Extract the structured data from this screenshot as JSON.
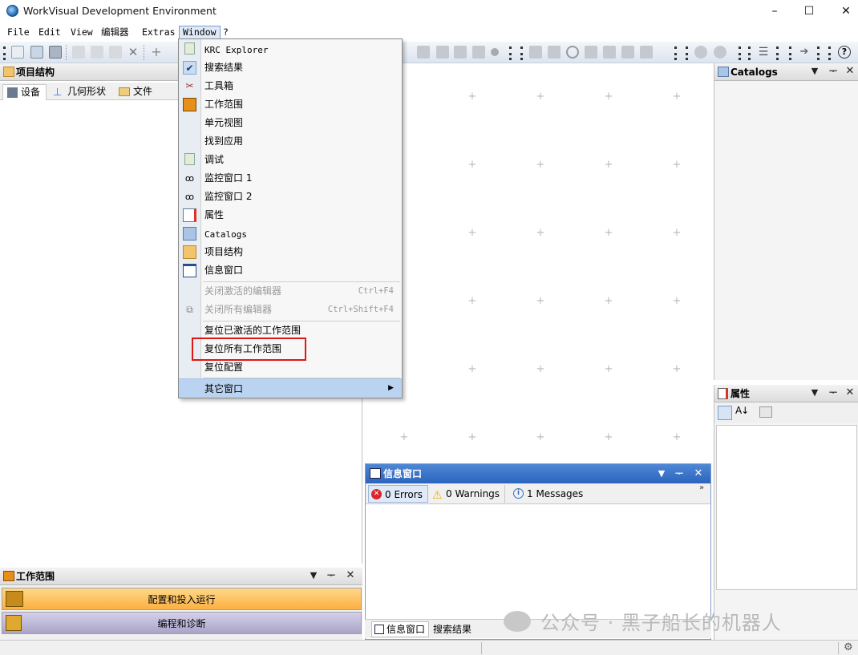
{
  "window": {
    "title": "WorkVisual Development Environment",
    "minimize": "–",
    "maximize": "☐",
    "close": "✕"
  },
  "menubar": {
    "file": "File",
    "edit": "Edit",
    "view": "View",
    "editor": "编辑器",
    "extras": "Extras",
    "window": "Window",
    "help": "?"
  },
  "project_panel": {
    "title": "项目结构",
    "tabs": [
      "设备",
      "几何形状",
      "文件"
    ]
  },
  "work_panel": {
    "title": "工作范围",
    "items": [
      "配置和投入运行",
      "编程和诊断"
    ]
  },
  "catalogs_panel": {
    "title": "Catalogs"
  },
  "properties_panel": {
    "title": "属性"
  },
  "info_window": {
    "title": "信息窗口",
    "errors": "0 Errors",
    "warnings": "0 Warnings",
    "messages": "1 Messages",
    "bottom_tabs": [
      "信息窗口",
      "搜索结果"
    ]
  },
  "window_menu": {
    "items": [
      {
        "label": "KRC Explorer",
        "icon": "krc-explorer-icon"
      },
      {
        "label": "搜索结果",
        "icon": "checkmark-icon"
      },
      {
        "label": "工具箱",
        "icon": "toolbox-icon"
      },
      {
        "label": "工作范围",
        "icon": "workspace-icon"
      },
      {
        "label": "单元视图",
        "icon": ""
      },
      {
        "label": "找到应用",
        "icon": ""
      },
      {
        "label": "调试",
        "icon": "debug-icon"
      },
      {
        "label": "监控窗口 1",
        "icon": "glasses-icon"
      },
      {
        "label": "监控窗口 2",
        "icon": "glasses-icon"
      },
      {
        "label": "属性",
        "icon": "properties-icon"
      },
      {
        "label": "Catalogs",
        "icon": "catalogs-icon"
      },
      {
        "label": "项目结构",
        "icon": "project-structure-icon"
      },
      {
        "label": "信息窗口",
        "icon": "info-window-icon"
      }
    ],
    "close_active": {
      "label": "关闭激活的编辑器",
      "shortcut": "Ctrl+F4"
    },
    "close_all": {
      "label": "关闭所有编辑器",
      "shortcut": "Ctrl+Shift+F4"
    },
    "reset_active": "复位已激活的工作范围",
    "reset_all": "复位所有工作范围",
    "reset_config": "复位配置",
    "other_windows": "其它窗口",
    "submenu_arrow": "▶"
  },
  "watermark": "公众号 · 黑子船长的机器人",
  "colors": {
    "highlight_border": "#e01515",
    "info_header": "#2b64bd",
    "config_bar": "#fbb041",
    "program_bar": "#a9a4c8",
    "menu_hover": "#bad3f0"
  }
}
